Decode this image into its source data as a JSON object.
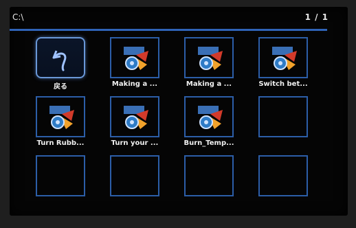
{
  "header": {
    "path": "C:\\",
    "page_count": "1 / 1"
  },
  "grid": {
    "items": [
      {
        "label": "戻る",
        "icon": "back-arrow-icon",
        "selected": true
      },
      {
        "label": "Making a ...",
        "icon": "video-file-icon"
      },
      {
        "label": "Making a ...",
        "icon": "video-file-icon"
      },
      {
        "label": "Switch bet...",
        "icon": "video-file-icon"
      },
      {
        "label": "Turn Rubb...",
        "icon": "video-file-icon"
      },
      {
        "label": "Turn your ...",
        "icon": "video-file-icon"
      },
      {
        "label": "Burn_Temp...",
        "icon": "video-file-icon"
      },
      {
        "label": "",
        "icon": ""
      },
      {
        "label": "",
        "icon": ""
      },
      {
        "label": "",
        "icon": ""
      },
      {
        "label": "",
        "icon": ""
      },
      {
        "label": "",
        "icon": ""
      }
    ]
  },
  "colors": {
    "accent": "#2f63b8",
    "tile_border": "#2c5ea8",
    "selected_border": "#6a98d8"
  }
}
